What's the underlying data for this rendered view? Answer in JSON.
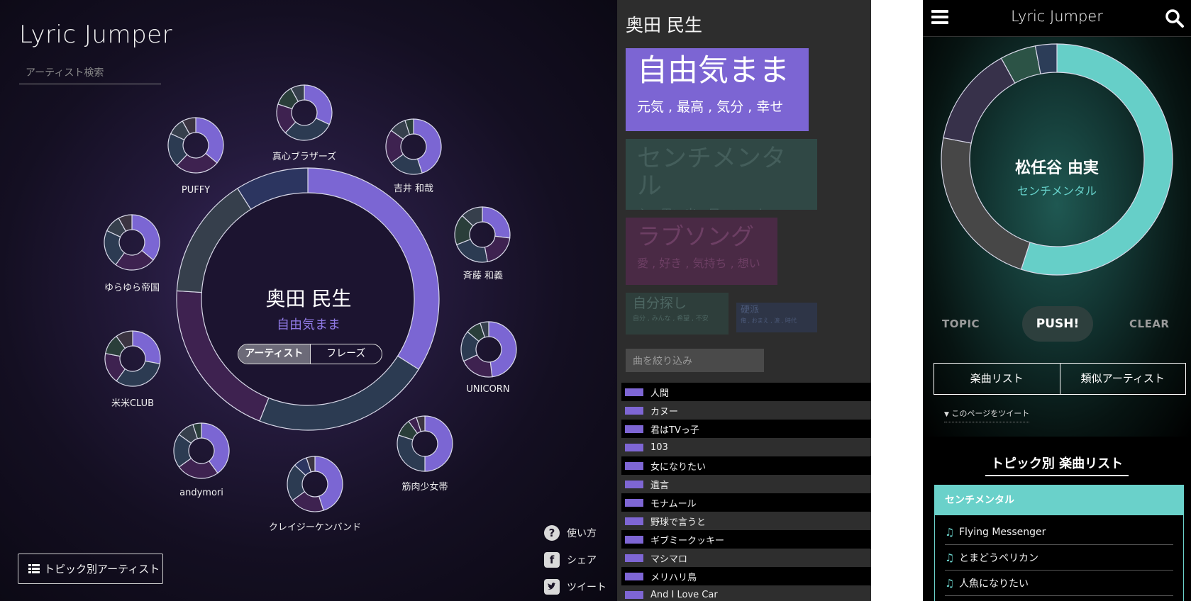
{
  "desktop": {
    "app_title": "Lyric Jumper",
    "search_placeholder": "アーティスト検索",
    "center": {
      "artist": "奥田 民生",
      "topic": "自由気まま",
      "toggle": [
        "アーティスト",
        "フレーズ"
      ],
      "toggle_active": "アーティスト"
    },
    "similar_artists": [
      "真心ブラザーズ",
      "吉井 和哉",
      "斉藤 和義",
      "UNICORN",
      "筋肉少女帯",
      "クレイジーケンバンド",
      "andymori",
      "米米CLUB",
      "ゆらゆら帝国",
      "PUFFY"
    ],
    "help_links": [
      {
        "icon": "help-icon",
        "label": "使い方"
      },
      {
        "icon": "facebook-icon",
        "label": "シェア"
      },
      {
        "icon": "twitter-icon",
        "label": "ツイート"
      }
    ],
    "topic_artist_button": "トピック別アーティスト",
    "accent_color": "#7b66d3"
  },
  "middle": {
    "artist": "奥田 民生",
    "topics": [
      {
        "title": "自由気まま",
        "keywords": "元気 , 最高 , 気分 , 幸せ",
        "active": true
      },
      {
        "title": "センチメンタル",
        "keywords": "心 , 思い出 , 風 , いつか",
        "active": false
      },
      {
        "title": "ラブソング",
        "keywords": "愛 , 好き , 気持ち , 想い",
        "active": false
      },
      {
        "title": "自分探し",
        "keywords": "自分 , みんな , 希望 , 不安",
        "active": false
      },
      {
        "title": "硬派",
        "keywords": "俺 , おまえ , 涙 , 時代",
        "active": false
      }
    ],
    "filter_placeholder": "曲を絞り込み",
    "songs": [
      "人間",
      "カヌー",
      "君はTVっ子",
      "103",
      "女になりたい",
      "遺言",
      "モナムール",
      "野球で言うと",
      "ギブミークッキー",
      "マシマロ",
      "メリハリ鳥",
      "And I Love Car"
    ]
  },
  "mobile": {
    "app_title": "Lyric Jumper",
    "artist": "松任谷 由実",
    "topic": "センチメンタル",
    "buttons": {
      "topic": "TOPIC",
      "push": "PUSH!",
      "clear": "CLEAR"
    },
    "tabs": [
      "楽曲リスト",
      "類似アーティスト"
    ],
    "tweet": "このページをツイート",
    "list_heading": "トピック別 楽曲リスト",
    "card_topic": "センチメンタル",
    "songs": [
      "Flying Messenger",
      "とまどうペリカン",
      "人魚になりたい"
    ],
    "accent_color": "#66cfc8"
  }
}
